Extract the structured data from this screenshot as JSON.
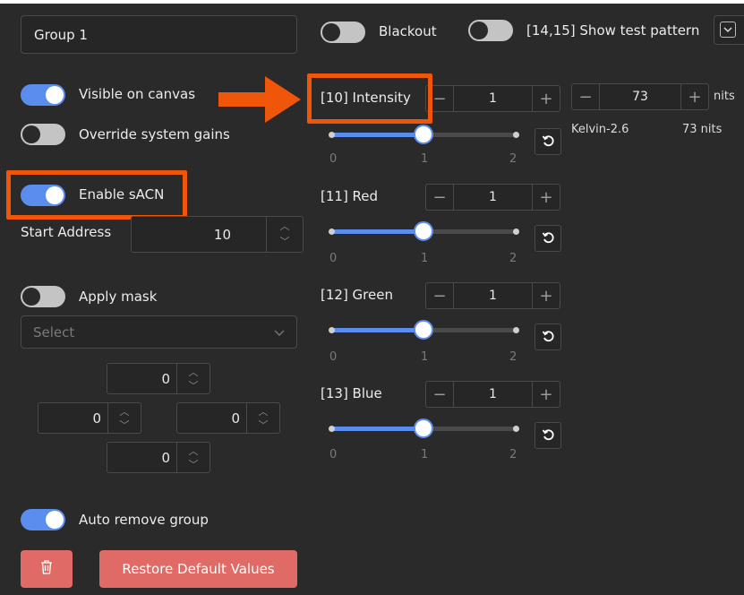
{
  "group_name": "Group 1",
  "top_bar": {
    "blackout_label": "Blackout",
    "test_pattern_label": "[14,15] Show test pattern"
  },
  "left": {
    "visible_on_canvas": "Visible on canvas",
    "override_system_gains": "Override system gains",
    "enable_sacn": "Enable sACN",
    "start_address_label": "Start Address",
    "start_address_value": "10",
    "apply_mask": "Apply mask",
    "mask_select_placeholder": "Select",
    "mask_top": "0",
    "mask_left": "0",
    "mask_right": "0",
    "mask_bottom": "0",
    "auto_remove_group": "Auto remove group",
    "restore_label": "Restore Default Values"
  },
  "channels": [
    {
      "label": "[10] Intensity",
      "value": "1",
      "ticks": [
        "0",
        "1",
        "2"
      ]
    },
    {
      "label": "[11] Red",
      "value": "1",
      "ticks": [
        "0",
        "1",
        "2"
      ]
    },
    {
      "label": "[12] Green",
      "value": "1",
      "ticks": [
        "0",
        "1",
        "2"
      ]
    },
    {
      "label": "[13] Blue",
      "value": "1",
      "ticks": [
        "0",
        "1",
        "2"
      ]
    }
  ],
  "nits": {
    "value": "73",
    "unit": "nits",
    "preset": "Kelvin-2.6",
    "readout": "73 nits"
  },
  "stepper_symbols": {
    "minus": "−",
    "plus": "+"
  },
  "colors": {
    "accent": "#5b8def",
    "highlight": "#f0560a",
    "danger": "#e06b66"
  }
}
